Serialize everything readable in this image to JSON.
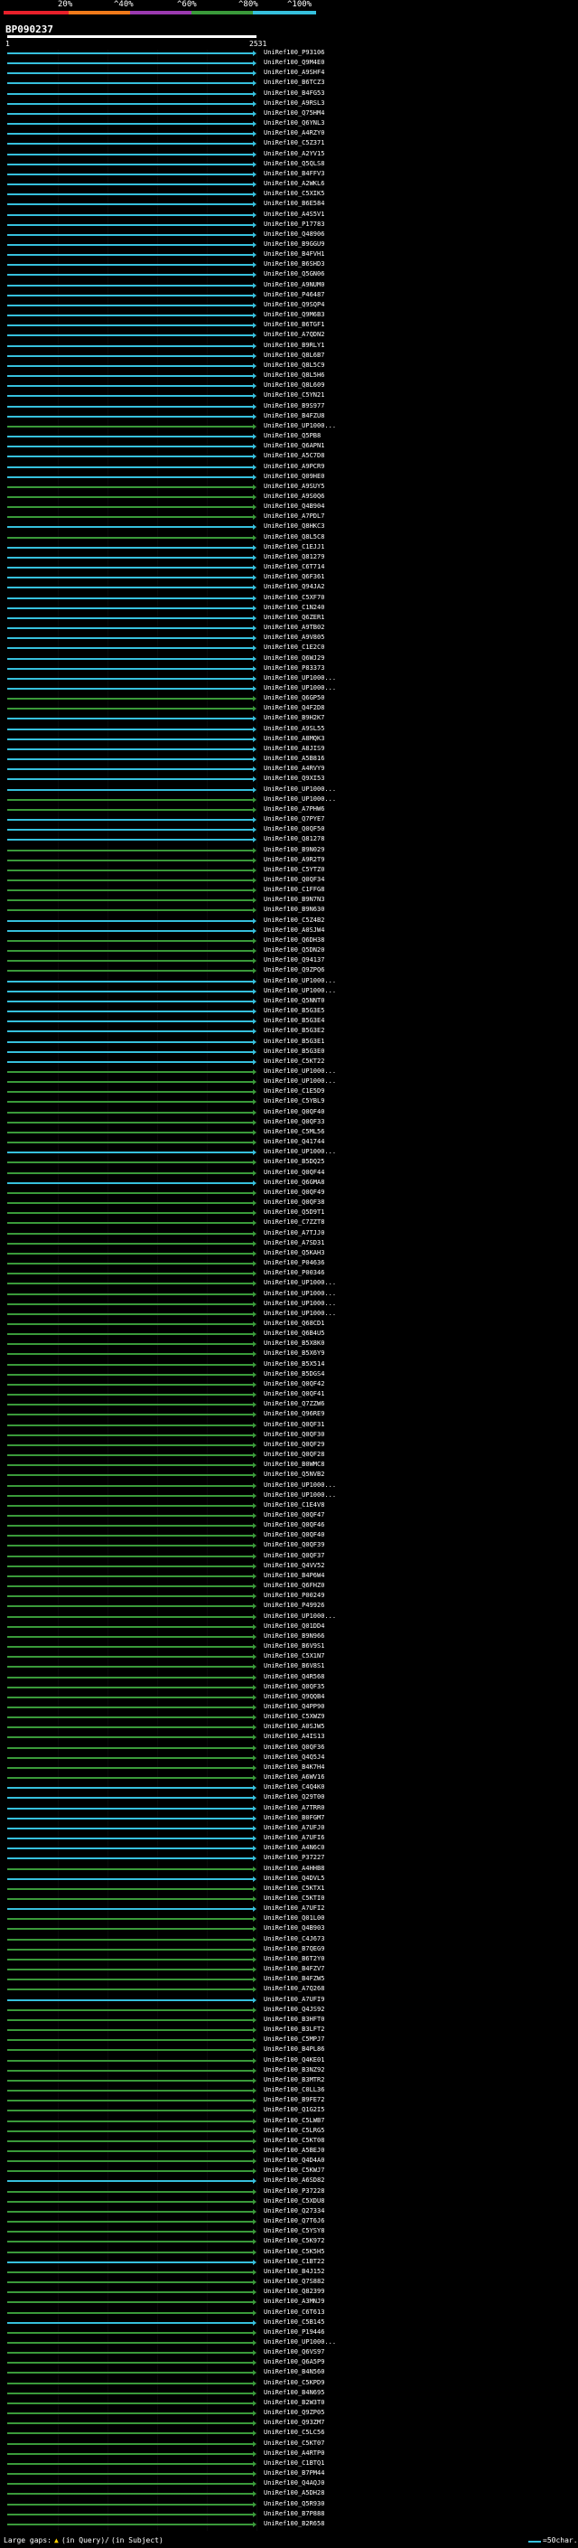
{
  "legend": {
    "colors": [
      "#e8202a",
      "#f07a1a",
      "#9b3ab0",
      "#3a9a3a",
      "#36c0dd"
    ],
    "labels": [
      "20%",
      "^40%",
      "^60%",
      "^80%",
      "^100%"
    ]
  },
  "query": {
    "id": "BP090237",
    "start_label": "1",
    "end_label": "2531"
  },
  "footer": {
    "large_gaps_label": "Large gaps:",
    "in_query_label": "(in Query)/",
    "in_subject_label": "(in Subject)",
    "scale_label": "=50char."
  },
  "hits": [
    {
      "label": "UniRef100_P93106",
      "color": "#36c0dd"
    },
    {
      "label": "UniRef100_Q9M4E0",
      "color": "#36c0dd"
    },
    {
      "label": "UniRef100_A9SHF4",
      "color": "#36c0dd"
    },
    {
      "label": "UniRef100_B6TCZ3",
      "color": "#36c0dd"
    },
    {
      "label": "UniRef100_B4FG53",
      "color": "#36c0dd"
    },
    {
      "label": "UniRef100_A9RSL3",
      "color": "#36c0dd"
    },
    {
      "label": "UniRef100_Q75HM4",
      "color": "#36c0dd"
    },
    {
      "label": "UniRef100_Q6YNL3",
      "color": "#36c0dd"
    },
    {
      "label": "UniRef100_A4RZY0",
      "color": "#36c0dd"
    },
    {
      "label": "UniRef100_C5Z371",
      "color": "#36c0dd"
    },
    {
      "label": "UniRef100_A2YV15",
      "color": "#36c0dd"
    },
    {
      "label": "UniRef100_Q5QLS8",
      "color": "#36c0dd"
    },
    {
      "label": "UniRef100_B4FFV3",
      "color": "#36c0dd"
    },
    {
      "label": "UniRef100_A2WKL6",
      "color": "#36c0dd"
    },
    {
      "label": "UniRef100_C5XIK5",
      "color": "#36c0dd"
    },
    {
      "label": "UniRef100_B6E584",
      "color": "#36c0dd"
    },
    {
      "label": "UniRef100_A4S5V1",
      "color": "#36c0dd"
    },
    {
      "label": "UniRef100_P17783",
      "color": "#36c0dd"
    },
    {
      "label": "UniRef100_Q48906",
      "color": "#36c0dd"
    },
    {
      "label": "UniRef100_B9GGU9",
      "color": "#36c0dd"
    },
    {
      "label": "UniRef100_B4FVH1",
      "color": "#36c0dd"
    },
    {
      "label": "UniRef100_B6SHD3",
      "color": "#36c0dd"
    },
    {
      "label": "UniRef100_Q5GN06",
      "color": "#36c0dd"
    },
    {
      "label": "UniRef100_A9NUM0",
      "color": "#36c0dd"
    },
    {
      "label": "UniRef100_P46487",
      "color": "#36c0dd"
    },
    {
      "label": "UniRef100_Q9SQP4",
      "color": "#36c0dd"
    },
    {
      "label": "UniRef100_Q9M6B3",
      "color": "#36c0dd"
    },
    {
      "label": "UniRef100_B6TGF1",
      "color": "#36c0dd"
    },
    {
      "label": "UniRef100_A7QDN2",
      "color": "#36c0dd"
    },
    {
      "label": "UniRef100_B9RLY1",
      "color": "#36c0dd"
    },
    {
      "label": "UniRef100_Q8L6B7",
      "color": "#36c0dd"
    },
    {
      "label": "UniRef100_Q8L5C9",
      "color": "#36c0dd"
    },
    {
      "label": "UniRef100_Q8L5H6",
      "color": "#36c0dd"
    },
    {
      "label": "UniRef100_Q8L609",
      "color": "#36c0dd"
    },
    {
      "label": "UniRef100_C5YN21",
      "color": "#36c0dd"
    },
    {
      "label": "UniRef100_B9S977",
      "color": "#36c0dd"
    },
    {
      "label": "UniRef100_B4FZU8",
      "color": "#36c0dd"
    },
    {
      "label": "UniRef100_UP1000...",
      "color": "#3a9a3a"
    },
    {
      "label": "UniRef100_Q5PB8",
      "color": "#36c0dd"
    },
    {
      "label": "UniRef100_Q6APN1",
      "color": "#36c0dd"
    },
    {
      "label": "UniRef100_A5C7D8",
      "color": "#36c0dd"
    },
    {
      "label": "UniRef100_A9PCR9",
      "color": "#36c0dd"
    },
    {
      "label": "UniRef100_Q09HE0",
      "color": "#36c0dd"
    },
    {
      "label": "UniRef100_A9SUY5",
      "color": "#3a9a3a"
    },
    {
      "label": "UniRef100_A9S0Q6",
      "color": "#3a9a3a"
    },
    {
      "label": "UniRef100_Q4B904",
      "color": "#3a9a3a"
    },
    {
      "label": "UniRef100_A7PDL7",
      "color": "#3a9a3a"
    },
    {
      "label": "UniRef100_Q8HKC3",
      "color": "#36c0dd"
    },
    {
      "label": "UniRef100_Q8L5C8",
      "color": "#3a9a3a"
    },
    {
      "label": "UniRef100_C1EJJ1",
      "color": "#36c0dd"
    },
    {
      "label": "UniRef100_Q81279",
      "color": "#36c0dd"
    },
    {
      "label": "UniRef100_C6T714",
      "color": "#36c0dd"
    },
    {
      "label": "UniRef100_Q6F361",
      "color": "#36c0dd"
    },
    {
      "label": "UniRef100_Q94JA2",
      "color": "#36c0dd"
    },
    {
      "label": "UniRef100_C5XF70",
      "color": "#36c0dd"
    },
    {
      "label": "UniRef100_C1N240",
      "color": "#36c0dd"
    },
    {
      "label": "UniRef100_Q6ZER1",
      "color": "#36c0dd"
    },
    {
      "label": "UniRef100_A9TB02",
      "color": "#36c0dd"
    },
    {
      "label": "UniRef100_A9V805",
      "color": "#36c0dd"
    },
    {
      "label": "UniRef100_C1E2C0",
      "color": "#36c0dd"
    },
    {
      "label": "UniRef100_Q6WJ29",
      "color": "#36c0dd"
    },
    {
      "label": "UniRef100_P83373",
      "color": "#36c0dd"
    },
    {
      "label": "UniRef100_UP1000...",
      "color": "#36c0dd"
    },
    {
      "label": "UniRef100_UP1000...",
      "color": "#36c0dd"
    },
    {
      "label": "UniRef100_Q6GP50",
      "color": "#3a9a3a"
    },
    {
      "label": "UniRef100_Q4F2D8",
      "color": "#3a9a3a"
    },
    {
      "label": "UniRef100_B9H2K7",
      "color": "#36c0dd"
    },
    {
      "label": "UniRef100_A9SL55",
      "color": "#36c0dd"
    },
    {
      "label": "UniRef100_A8MQK3",
      "color": "#36c0dd"
    },
    {
      "label": "UniRef100_A8JIS9",
      "color": "#36c0dd"
    },
    {
      "label": "UniRef100_A5B816",
      "color": "#36c0dd"
    },
    {
      "label": "UniRef100_A4RVY9",
      "color": "#36c0dd"
    },
    {
      "label": "UniRef100_Q9XI53",
      "color": "#36c0dd"
    },
    {
      "label": "UniRef100_UP1000...",
      "color": "#36c0dd"
    },
    {
      "label": "UniRef100_UP1000...",
      "color": "#3a9a3a"
    },
    {
      "label": "UniRef100_A7PHW6",
      "color": "#3a9a3a"
    },
    {
      "label": "UniRef100_Q7PYE7",
      "color": "#36c0dd"
    },
    {
      "label": "UniRef100_Q0QF50",
      "color": "#36c0dd"
    },
    {
      "label": "UniRef100_Q81278",
      "color": "#36c0dd"
    },
    {
      "label": "UniRef100_B9N029",
      "color": "#3a9a3a"
    },
    {
      "label": "UniRef100_A9R2T9",
      "color": "#3a9a3a"
    },
    {
      "label": "UniRef100_C5YTZ0",
      "color": "#3a9a3a"
    },
    {
      "label": "UniRef100_Q0QF34",
      "color": "#3a9a3a"
    },
    {
      "label": "UniRef100_C1FFG8",
      "color": "#3a9a3a"
    },
    {
      "label": "UniRef100_B9N7N3",
      "color": "#3a9a3a"
    },
    {
      "label": "UniRef100_B9N630",
      "color": "#3a9a3a"
    },
    {
      "label": "UniRef100_C5Z4B2",
      "color": "#36c0dd"
    },
    {
      "label": "UniRef100_A0SJW4",
      "color": "#36c0dd"
    },
    {
      "label": "UniRef100_Q6DH38",
      "color": "#3a9a3a"
    },
    {
      "label": "UniRef100_Q5DN20",
      "color": "#3a9a3a"
    },
    {
      "label": "UniRef100_Q94137",
      "color": "#3a9a3a"
    },
    {
      "label": "UniRef100_Q9ZPQ6",
      "color": "#3a9a3a"
    },
    {
      "label": "UniRef100_UP1000...",
      "color": "#36c0dd"
    },
    {
      "label": "UniRef100_UP1000...",
      "color": "#36c0dd"
    },
    {
      "label": "UniRef100_Q5NNT0",
      "color": "#36c0dd"
    },
    {
      "label": "UniRef100_B5G3E5",
      "color": "#36c0dd"
    },
    {
      "label": "UniRef100_B5G3E4",
      "color": "#36c0dd"
    },
    {
      "label": "UniRef100_B5G3E2",
      "color": "#36c0dd"
    },
    {
      "label": "UniRef100_B5G3E1",
      "color": "#36c0dd"
    },
    {
      "label": "UniRef100_B5G3E0",
      "color": "#36c0dd"
    },
    {
      "label": "UniRef100_C5KT22",
      "color": "#36c0dd"
    },
    {
      "label": "UniRef100_UP1000...",
      "color": "#3a9a3a"
    },
    {
      "label": "UniRef100_UP1000...",
      "color": "#3a9a3a"
    },
    {
      "label": "UniRef100_C1E5D9",
      "color": "#3a9a3a"
    },
    {
      "label": "UniRef100_C5YBL9",
      "color": "#3a9a3a"
    },
    {
      "label": "UniRef100_Q0QF40",
      "color": "#3a9a3a"
    },
    {
      "label": "UniRef100_Q0QF33",
      "color": "#3a9a3a"
    },
    {
      "label": "UniRef100_C5ML56",
      "color": "#3a9a3a"
    },
    {
      "label": "UniRef100_Q41744",
      "color": "#3a9a3a"
    },
    {
      "label": "UniRef100_UP1000...",
      "color": "#36c0dd"
    },
    {
      "label": "UniRef100_B5DQ25",
      "color": "#3a9a3a"
    },
    {
      "label": "UniRef100_Q0QF44",
      "color": "#3a9a3a"
    },
    {
      "label": "UniRef100_Q6GMA8",
      "color": "#36c0dd"
    },
    {
      "label": "UniRef100_Q0QF49",
      "color": "#3a9a3a"
    },
    {
      "label": "UniRef100_Q0QF38",
      "color": "#3a9a3a"
    },
    {
      "label": "UniRef100_Q5D9T1",
      "color": "#3a9a3a"
    },
    {
      "label": "UniRef100_C7ZZT8",
      "color": "#3a9a3a"
    },
    {
      "label": "UniRef100_A7TJJ0",
      "color": "#3a9a3a"
    },
    {
      "label": "UniRef100_A7SD31",
      "color": "#3a9a3a"
    },
    {
      "label": "UniRef100_Q5KAH3",
      "color": "#3a9a3a"
    },
    {
      "label": "UniRef100_P04636",
      "color": "#3a9a3a"
    },
    {
      "label": "UniRef100_P00346",
      "color": "#3a9a3a"
    },
    {
      "label": "UniRef100_UP1000...",
      "color": "#3a9a3a"
    },
    {
      "label": "UniRef100_UP1000...",
      "color": "#3a9a3a"
    },
    {
      "label": "UniRef100_UP1000...",
      "color": "#3a9a3a"
    },
    {
      "label": "UniRef100_UP1000...",
      "color": "#3a9a3a"
    },
    {
      "label": "UniRef100_Q68CD1",
      "color": "#3a9a3a"
    },
    {
      "label": "UniRef100_Q6B4U5",
      "color": "#3a9a3a"
    },
    {
      "label": "UniRef100_B5X8K0",
      "color": "#3a9a3a"
    },
    {
      "label": "UniRef100_B5X6Y9",
      "color": "#3a9a3a"
    },
    {
      "label": "UniRef100_B5X514",
      "color": "#3a9a3a"
    },
    {
      "label": "UniRef100_B5DGS4",
      "color": "#3a9a3a"
    },
    {
      "label": "UniRef100_Q0QF42",
      "color": "#3a9a3a"
    },
    {
      "label": "UniRef100_Q0QF41",
      "color": "#3a9a3a"
    },
    {
      "label": "UniRef100_Q7ZZW6",
      "color": "#3a9a3a"
    },
    {
      "label": "UniRef100_Q96RE9",
      "color": "#3a9a3a"
    },
    {
      "label": "UniRef100_Q0QF31",
      "color": "#3a9a3a"
    },
    {
      "label": "UniRef100_Q0QF30",
      "color": "#3a9a3a"
    },
    {
      "label": "UniRef100_Q0QF29",
      "color": "#3a9a3a"
    },
    {
      "label": "UniRef100_Q0QF28",
      "color": "#3a9a3a"
    },
    {
      "label": "UniRef100_B0WMC8",
      "color": "#3a9a3a"
    },
    {
      "label": "UniRef100_Q5NVB2",
      "color": "#3a9a3a"
    },
    {
      "label": "UniRef100_UP1000...",
      "color": "#3a9a3a"
    },
    {
      "label": "UniRef100_UP1000...",
      "color": "#3a9a3a"
    },
    {
      "label": "UniRef100_C1E4V8",
      "color": "#3a9a3a"
    },
    {
      "label": "UniRef100_Q0QF47",
      "color": "#3a9a3a"
    },
    {
      "label": "UniRef100_Q0QF46",
      "color": "#3a9a3a"
    },
    {
      "label": "UniRef100_Q0QF40",
      "color": "#3a9a3a"
    },
    {
      "label": "UniRef100_Q0QF39",
      "color": "#3a9a3a"
    },
    {
      "label": "UniRef100_Q0QF37",
      "color": "#3a9a3a"
    },
    {
      "label": "UniRef100_Q4VV52",
      "color": "#3a9a3a"
    },
    {
      "label": "UniRef100_B4P6W4",
      "color": "#3a9a3a"
    },
    {
      "label": "UniRef100_Q6FHZ0",
      "color": "#3a9a3a"
    },
    {
      "label": "UniRef100_P00249",
      "color": "#3a9a3a"
    },
    {
      "label": "UniRef100_P49926",
      "color": "#3a9a3a"
    },
    {
      "label": "UniRef100_UP1000...",
      "color": "#3a9a3a"
    },
    {
      "label": "UniRef100_Q01DD4",
      "color": "#3a9a3a"
    },
    {
      "label": "UniRef100_B9N966",
      "color": "#3a9a3a"
    },
    {
      "label": "UniRef100_B6V9S1",
      "color": "#3a9a3a"
    },
    {
      "label": "UniRef100_C5X1N7",
      "color": "#3a9a3a"
    },
    {
      "label": "UniRef100_B6V8S1",
      "color": "#3a9a3a"
    },
    {
      "label": "UniRef100_Q4R568",
      "color": "#3a9a3a"
    },
    {
      "label": "UniRef100_Q0QF35",
      "color": "#3a9a3a"
    },
    {
      "label": "UniRef100_Q9QQB4",
      "color": "#3a9a3a"
    },
    {
      "label": "UniRef100_Q4PP90",
      "color": "#3a9a3a"
    },
    {
      "label": "UniRef100_C5XWZ9",
      "color": "#3a9a3a"
    },
    {
      "label": "UniRef100_A0SJW5",
      "color": "#3a9a3a"
    },
    {
      "label": "UniRef100_A4IS13",
      "color": "#3a9a3a"
    },
    {
      "label": "UniRef100_Q0QF36",
      "color": "#3a9a3a"
    },
    {
      "label": "UniRef100_Q4Q5J4",
      "color": "#3a9a3a"
    },
    {
      "label": "UniRef100_B4K7H4",
      "color": "#3a9a3a"
    },
    {
      "label": "UniRef100_A6WV16",
      "color": "#3a9a3a"
    },
    {
      "label": "UniRef100_C4Q4K0",
      "color": "#36c0dd"
    },
    {
      "label": "UniRef100_Q29T00",
      "color": "#36c0dd"
    },
    {
      "label": "UniRef100_A7TRR0",
      "color": "#36c0dd"
    },
    {
      "label": "UniRef100_B0FGM7",
      "color": "#36c0dd"
    },
    {
      "label": "UniRef100_A7UFJ0",
      "color": "#36c0dd"
    },
    {
      "label": "UniRef100_A7UFI6",
      "color": "#36c0dd"
    },
    {
      "label": "UniRef100_A4N6C0",
      "color": "#36c0dd"
    },
    {
      "label": "UniRef100_P37227",
      "color": "#36c0dd"
    },
    {
      "label": "UniRef100_A4HHB8",
      "color": "#3a9a3a"
    },
    {
      "label": "UniRef100_Q4DVL5",
      "color": "#36c0dd"
    },
    {
      "label": "UniRef100_C5KTX1",
      "color": "#3a9a3a"
    },
    {
      "label": "UniRef100_C5KTI0",
      "color": "#3a9a3a"
    },
    {
      "label": "UniRef100_A7UFI2",
      "color": "#36c0dd"
    },
    {
      "label": "UniRef100_Q01L00",
      "color": "#3a9a3a"
    },
    {
      "label": "UniRef100_Q4B903",
      "color": "#3a9a3a"
    },
    {
      "label": "UniRef100_C4J673",
      "color": "#3a9a3a"
    },
    {
      "label": "UniRef100_B7QEG9",
      "color": "#3a9a3a"
    },
    {
      "label": "UniRef100_B6T2Y0",
      "color": "#3a9a3a"
    },
    {
      "label": "UniRef100_B4FZV7",
      "color": "#3a9a3a"
    },
    {
      "label": "UniRef100_B4FZW5",
      "color": "#3a9a3a"
    },
    {
      "label": "UniRef100_A7Q268",
      "color": "#3a9a3a"
    },
    {
      "label": "UniRef100_A7UFI9",
      "color": "#36c0dd"
    },
    {
      "label": "UniRef100_Q4JS92",
      "color": "#3a9a3a"
    },
    {
      "label": "UniRef100_B3HFT0",
      "color": "#3a9a3a"
    },
    {
      "label": "UniRef100_B3LFT2",
      "color": "#3a9a3a"
    },
    {
      "label": "UniRef100_C5MPJ7",
      "color": "#3a9a3a"
    },
    {
      "label": "UniRef100_B4PL86",
      "color": "#3a9a3a"
    },
    {
      "label": "UniRef100_Q4KE01",
      "color": "#3a9a3a"
    },
    {
      "label": "UniRef100_B3NZ92",
      "color": "#3a9a3a"
    },
    {
      "label": "UniRef100_B3MTR2",
      "color": "#3a9a3a"
    },
    {
      "label": "UniRef100_C0LL36",
      "color": "#3a9a3a"
    },
    {
      "label": "UniRef100_B9FE72",
      "color": "#3a9a3a"
    },
    {
      "label": "UniRef100_Q1G2I5",
      "color": "#3a9a3a"
    },
    {
      "label": "UniRef100_C5LWB7",
      "color": "#3a9a3a"
    },
    {
      "label": "UniRef100_C5LRG5",
      "color": "#3a9a3a"
    },
    {
      "label": "UniRef100_C5KT08",
      "color": "#3a9a3a"
    },
    {
      "label": "UniRef100_A5BEJ0",
      "color": "#3a9a3a"
    },
    {
      "label": "UniRef100_Q4D4A0",
      "color": "#3a9a3a"
    },
    {
      "label": "UniRef100_C5KWJ7",
      "color": "#3a9a3a"
    },
    {
      "label": "UniRef100_A6SD82",
      "color": "#36c0dd"
    },
    {
      "label": "UniRef100_P37228",
      "color": "#3a9a3a"
    },
    {
      "label": "UniRef100_C5XDU8",
      "color": "#3a9a3a"
    },
    {
      "label": "UniRef100_Q27334",
      "color": "#3a9a3a"
    },
    {
      "label": "UniRef100_Q7T6J6",
      "color": "#3a9a3a"
    },
    {
      "label": "UniRef100_C5YSY8",
      "color": "#3a9a3a"
    },
    {
      "label": "UniRef100_C5K972",
      "color": "#3a9a3a"
    },
    {
      "label": "UniRef100_C5K5H5",
      "color": "#3a9a3a"
    },
    {
      "label": "UniRef100_C1BT22",
      "color": "#36c0dd"
    },
    {
      "label": "UniRef100_B4J152",
      "color": "#3a9a3a"
    },
    {
      "label": "UniRef100_Q7S882",
      "color": "#3a9a3a"
    },
    {
      "label": "UniRef100_Q82399",
      "color": "#3a9a3a"
    },
    {
      "label": "UniRef100_A3MNJ9",
      "color": "#3a9a3a"
    },
    {
      "label": "UniRef100_C6T613",
      "color": "#3a9a3a"
    },
    {
      "label": "UniRef100_C5B145",
      "color": "#36c0dd"
    },
    {
      "label": "UniRef100_P19446",
      "color": "#3a9a3a"
    },
    {
      "label": "UniRef100_UP1000...",
      "color": "#3a9a3a"
    },
    {
      "label": "UniRef100_Q6VS97",
      "color": "#3a9a3a"
    },
    {
      "label": "UniRef100_Q6A5P9",
      "color": "#3a9a3a"
    },
    {
      "label": "UniRef100_B4N560",
      "color": "#3a9a3a"
    },
    {
      "label": "UniRef100_C5KPD9",
      "color": "#3a9a3a"
    },
    {
      "label": "UniRef100_B4N695",
      "color": "#3a9a3a"
    },
    {
      "label": "UniRef100_B2W3T0",
      "color": "#3a9a3a"
    },
    {
      "label": "UniRef100_Q9ZP05",
      "color": "#3a9a3a"
    },
    {
      "label": "UniRef100_Q93ZM7",
      "color": "#3a9a3a"
    },
    {
      "label": "UniRef100_C5LC56",
      "color": "#3a9a3a"
    },
    {
      "label": "UniRef100_C5KT07",
      "color": "#3a9a3a"
    },
    {
      "label": "UniRef100_A4RTP0",
      "color": "#3a9a3a"
    },
    {
      "label": "UniRef100_C1BTQ1",
      "color": "#3a9a3a"
    },
    {
      "label": "UniRef100_B7PM44",
      "color": "#3a9a3a"
    },
    {
      "label": "UniRef100_Q4AQJ0",
      "color": "#3a9a3a"
    },
    {
      "label": "UniRef100_A5DH28",
      "color": "#3a9a3a"
    },
    {
      "label": "UniRef100_Q5R930",
      "color": "#3a9a3a"
    },
    {
      "label": "UniRef100_B7P888",
      "color": "#3a9a3a"
    },
    {
      "label": "UniRef100_B2R658",
      "color": "#3a9a3a"
    }
  ]
}
